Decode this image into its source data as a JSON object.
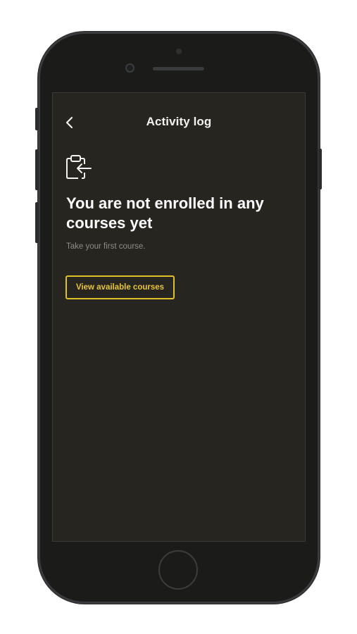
{
  "header": {
    "title": "Activity log",
    "back_icon": "chevron-left-icon"
  },
  "empty_state": {
    "icon": "clipboard-arrow-left-icon",
    "headline": "You are not enrolled in any courses yet",
    "subtext": "Take your first course.",
    "cta_label": "View available courses"
  },
  "colors": {
    "screen_background": "#27251f",
    "accent": "#e2bf2a",
    "text_primary": "#ffffff",
    "text_secondary": "#8e8c85"
  }
}
